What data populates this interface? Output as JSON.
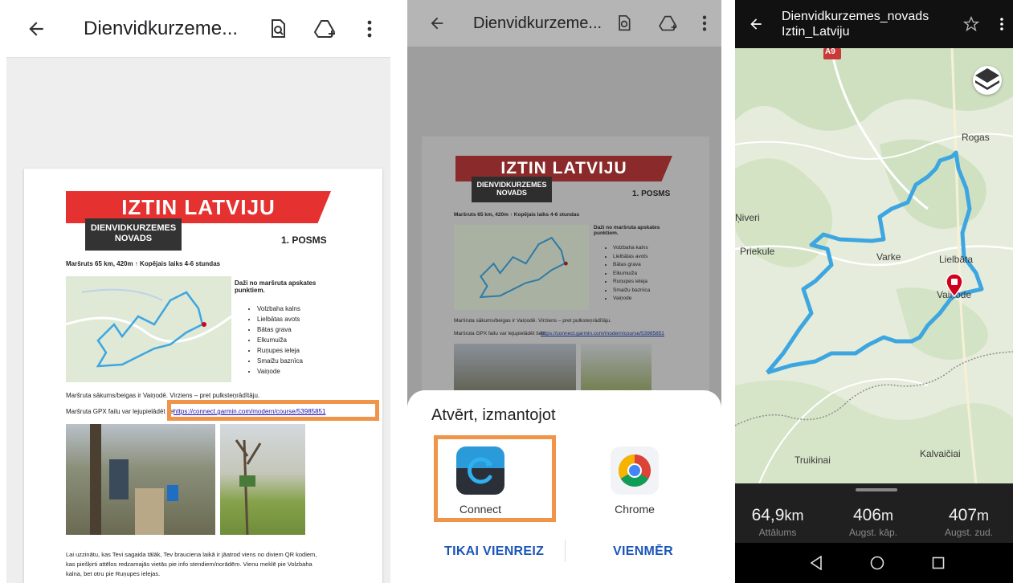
{
  "panel1": {
    "title": "Dienvidkurzeme...",
    "doc": {
      "banner": "IZTIN LATVIJU",
      "subbanner": "DIENVIDKURZEMES NOVADS",
      "posms": "1. POSMS",
      "route_summary": "Maršruts 65 km, 420m ↑ Kopējais laiks 4-6 stundas",
      "points_heading": "Daži no maršruta apskates punktiem.",
      "points": [
        "Volzbaha kalns",
        "Lielbātas avots",
        "Bātas grava",
        "Elkumuiža",
        "Ruņupes ieleja",
        "Smaižu baznīca",
        "Vaiņode"
      ],
      "start_text": "Maršruta sākums/beigas ir Vaiņodē. Virziens – pret pulksteņrādītāju.",
      "gpx_text": "Maršruta GPX failu var lejupielādēt še",
      "gpx_link": "https://connect.garmin.com/modern/course/53985851",
      "footer": [
        "Lai uzzinātu, kas Tevi sagaida tālāk, Tev braucienа laikā ir jāatrod viens no diviem QR kodiem,",
        "kas piešķirti attēlos redzamajās vietās pie info stendiem/norādēm. Vienu meklē pie Volzbaha",
        "kalna, bet otru pie Ruņupes ielejas."
      ]
    }
  },
  "panel2": {
    "title": "Dienvidkurzeme...",
    "doc": {
      "banner": "IZTIN LATVIJU",
      "subbanner": "DIENVIDKURZEMES NOVADS",
      "posms": "1. POSMS",
      "route_summary": "Maršruts 65 km, 420m ↑ Kopējais laiks 4-6 stundas",
      "points_heading": "Daži no maršruta apskates punktiem.",
      "points": [
        "Volzbaha kalns",
        "Lielbātas avots",
        "Bātas grava",
        "Elkumuiža",
        "Ruņupes ieleja",
        "Smaižu baznīca",
        "Vaiņode"
      ],
      "start_text": "Maršruta sākums/beigas ir Vaiņodē. Virziens – pret pulksteņrādītāju.",
      "gpx_text": "Maršruta GPX failu var lejupielādēt šeit:",
      "gpx_link": "https://connect.garmin.com/modern/course/53985851"
    },
    "sheet": {
      "title": "Atvērt, izmantojot",
      "apps": [
        "Connect",
        "Chrome"
      ],
      "once": "TIKAI VIENREIZ",
      "always": "VIENMĒR"
    }
  },
  "panel3": {
    "title_line1": "Dienvidkurzemes_novads",
    "title_line2": "Iztin_Latviju",
    "road_label": "A9",
    "places": [
      "Rogas",
      "Ņiveri",
      "Priekule",
      "Varkе",
      "Lielbāta",
      "Vaiņode",
      "Truikinai",
      "Kalvaičiai"
    ],
    "stats": [
      {
        "value": "64,9",
        "unit": "km",
        "label": "Attālums"
      },
      {
        "value": "406",
        "unit": "m",
        "label": "Augst. kāp."
      },
      {
        "value": "407",
        "unit": "m",
        "label": "Augst. zud."
      }
    ]
  },
  "colors": {
    "accent_orange": "#f0944a",
    "route_blue": "#3da6e0",
    "banner_red": "#e63131",
    "pin_red": "#d0021b"
  }
}
